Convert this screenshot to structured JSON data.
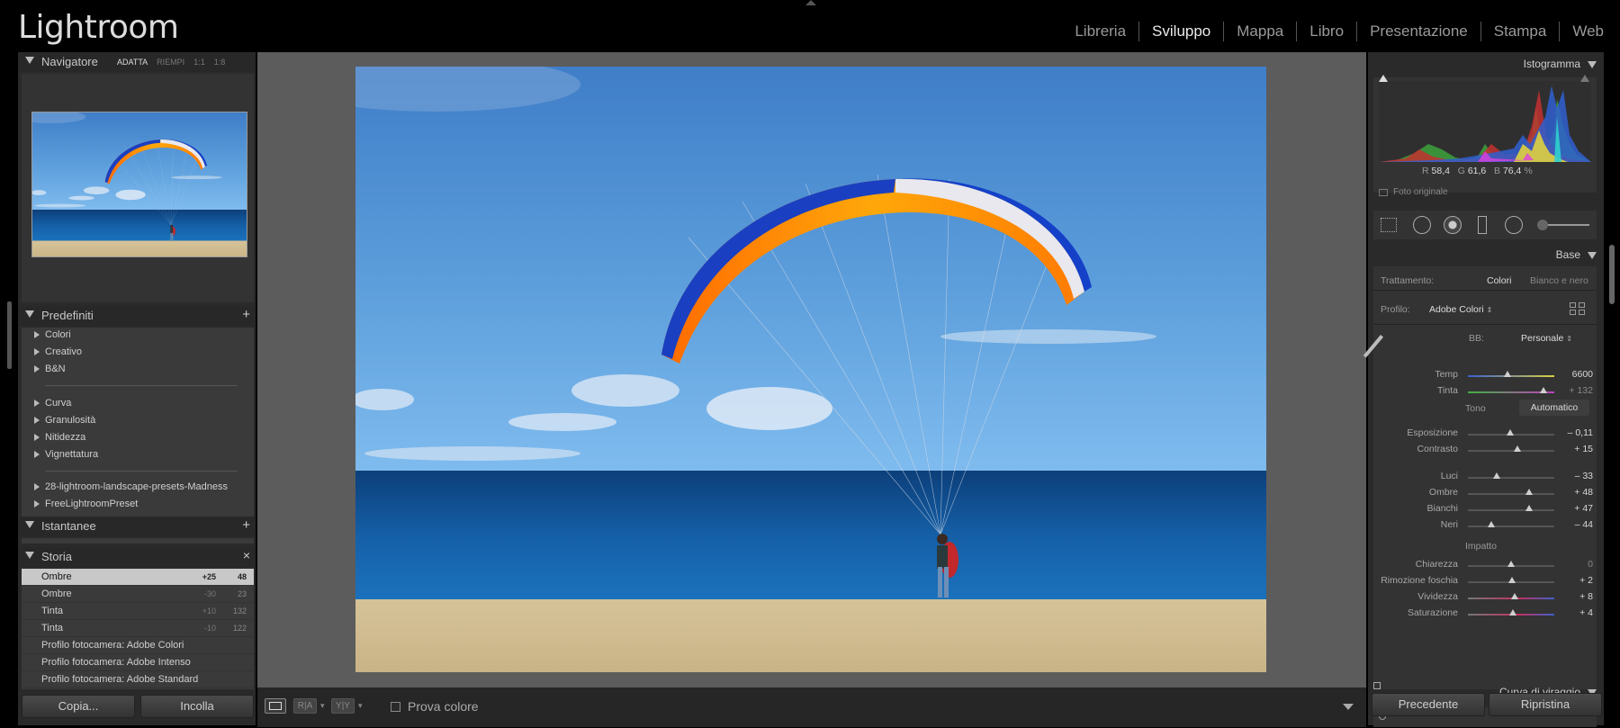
{
  "app": {
    "logo": "Lightroom"
  },
  "modules": [
    "Libreria",
    "Sviluppo",
    "Mappa",
    "Libro",
    "Presentazione",
    "Stampa",
    "Web"
  ],
  "active_module": "Sviluppo",
  "left": {
    "navigator": {
      "title": "Navigatore",
      "options": [
        "ADATTA",
        "RIEMPI",
        "1:1",
        "1:8"
      ]
    },
    "presets": {
      "title": "Predefiniti",
      "groups": [
        "Colori",
        "Creativo",
        "B&N",
        "Curva",
        "Granulosità",
        "Nitidezza",
        "Vignettatura",
        "28-lightroom-landscape-presets-Madness",
        "FreeLightroomPreset"
      ]
    },
    "snapshots": {
      "title": "Istantanee"
    },
    "history": {
      "title": "Storia",
      "items": [
        {
          "name": "Ombre",
          "from": "+25",
          "to": "48"
        },
        {
          "name": "Ombre",
          "from": "-30",
          "to": "23"
        },
        {
          "name": "Tinta",
          "from": "+10",
          "to": "132"
        },
        {
          "name": "Tinta",
          "from": "-10",
          "to": "122"
        },
        {
          "name": "Profilo fotocamera: Adobe Colori",
          "from": "",
          "to": ""
        },
        {
          "name": "Profilo fotocamera: Adobe Intenso",
          "from": "",
          "to": ""
        },
        {
          "name": "Profilo fotocamera: Adobe Standard",
          "from": "",
          "to": ""
        }
      ]
    },
    "copy_label": "Copia...",
    "paste_label": "Incolla"
  },
  "toolbar": {
    "softproof_label": "Prova colore"
  },
  "right": {
    "histogram": {
      "title": "Istogramma",
      "r_label": "R",
      "r": "58,4",
      "g_label": "G",
      "g": "61,6",
      "b_label": "B",
      "b": "76,4",
      "unit": "%",
      "original": "Foto originale"
    },
    "basic": {
      "title": "Base",
      "treatment_label": "Trattamento:",
      "treatment_color": "Colori",
      "treatment_bw": "Bianco e nero",
      "profile_label": "Profilo:",
      "profile_value": "Adobe Colori",
      "wb_label": "BB:",
      "wb_value": "Personale",
      "tone_label": "Tono",
      "auto_label": "Automatico",
      "presence_label": "Impatto",
      "sliders": [
        {
          "label": "Temp",
          "value": "6600",
          "pos": 0.46
        },
        {
          "label": "Tinta",
          "value": "+ 132",
          "pos": 0.88
        },
        {
          "label": "Esposizione",
          "value": "– 0,11",
          "pos": 0.49
        },
        {
          "label": "Contrasto",
          "value": "+ 15",
          "pos": 0.57
        },
        {
          "label": "Luci",
          "value": "– 33",
          "pos": 0.33
        },
        {
          "label": "Ombre",
          "value": "+ 48",
          "pos": 0.71
        },
        {
          "label": "Bianchi",
          "value": "+ 47",
          "pos": 0.71
        },
        {
          "label": "Neri",
          "value": "– 44",
          "pos": 0.27
        },
        {
          "label": "Chiarezza",
          "value": "0",
          "pos": 0.5
        },
        {
          "label": "Rimozione foschia",
          "value": "+ 2",
          "pos": 0.51
        },
        {
          "label": "Vividezza",
          "value": "+ 8",
          "pos": 0.54
        },
        {
          "label": "Saturazione",
          "value": "+ 4",
          "pos": 0.52
        }
      ]
    },
    "tone_curve_title": "Curva di viraggio",
    "prev_label": "Precedente",
    "reset_label": "Ripristina"
  }
}
